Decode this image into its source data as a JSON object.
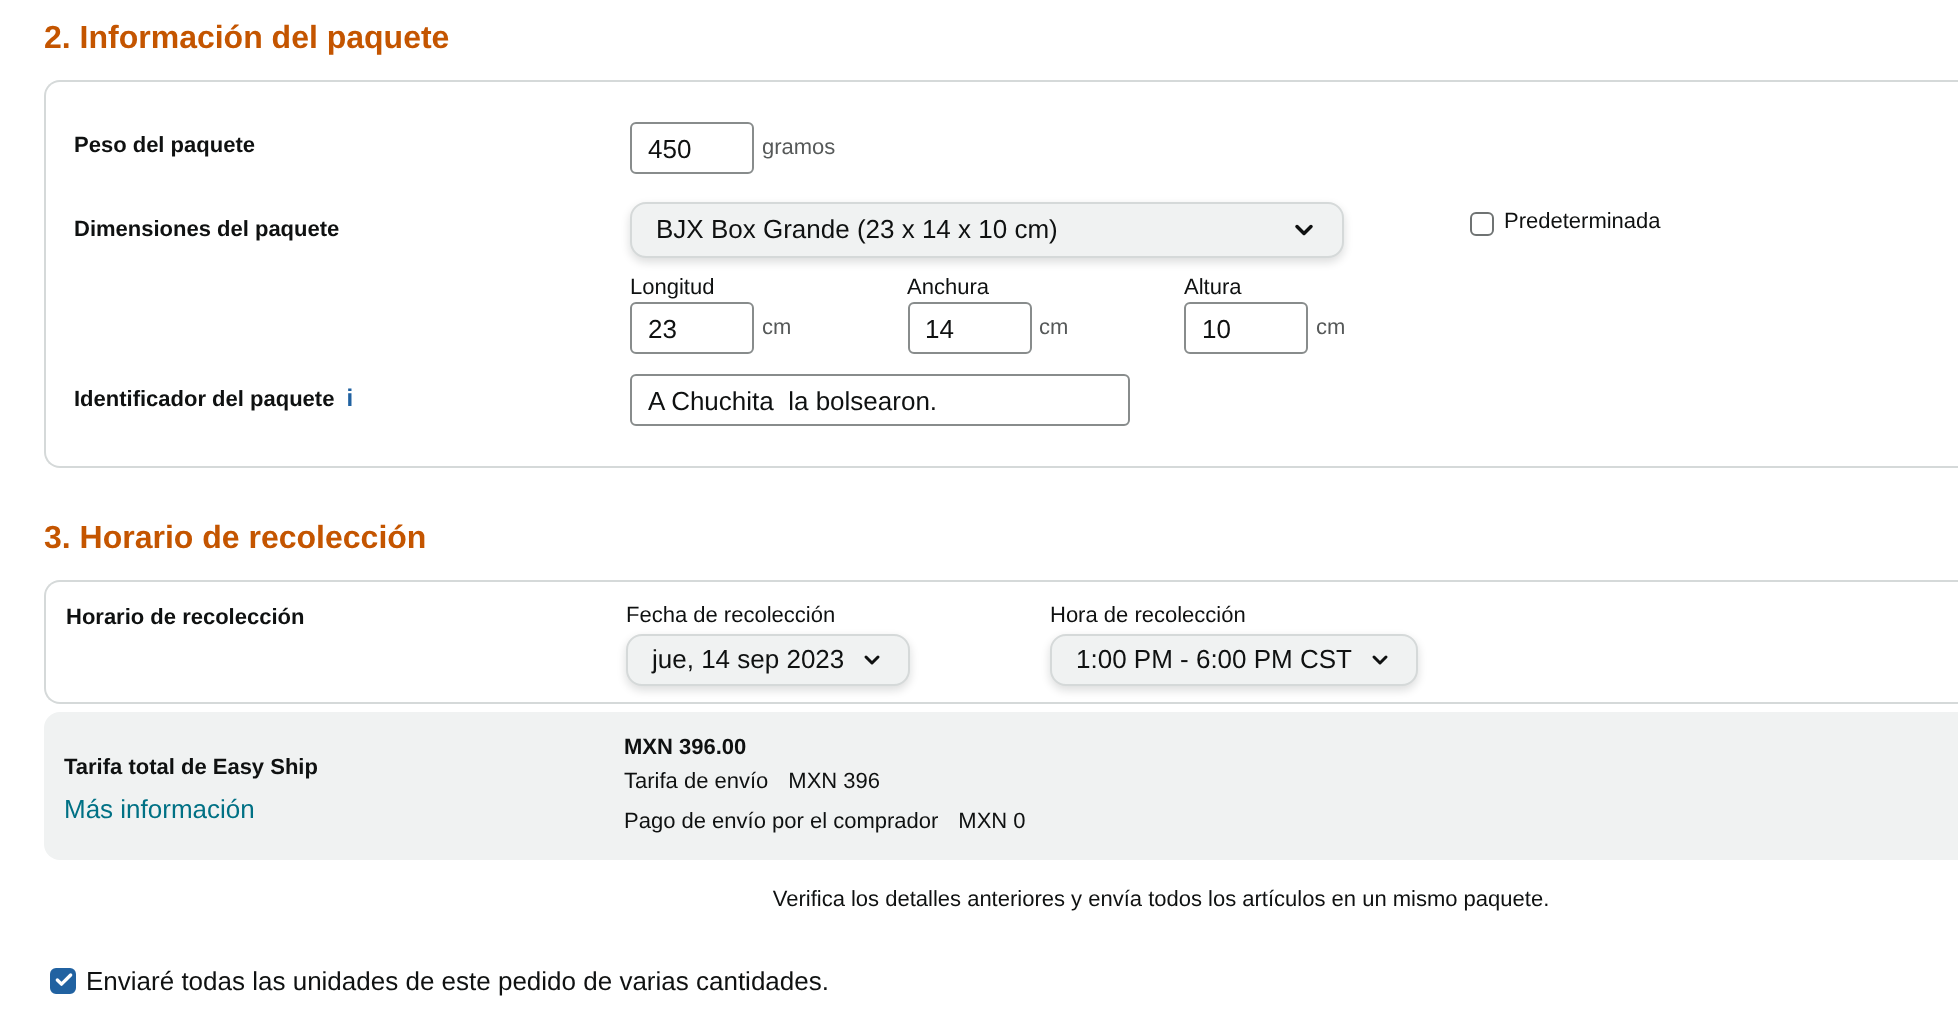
{
  "package_section": {
    "title": "2. Información del paquete",
    "weight": {
      "label": "Peso del paquete",
      "value": "450",
      "unit": "gramos"
    },
    "dimensions": {
      "label": "Dimensiones del paquete",
      "selected_box": "BJX Box Grande (23 x 14 x 10 cm)",
      "default": {
        "label": "Predeterminada",
        "checked": false
      },
      "fields": [
        {
          "label": "Longitud",
          "value": "23",
          "unit": "cm"
        },
        {
          "label": "Anchura",
          "value": "14",
          "unit": "cm"
        },
        {
          "label": "Altura",
          "value": "10",
          "unit": "cm"
        }
      ]
    },
    "identifier": {
      "label": "Identificador del paquete",
      "info": "i",
      "value": "A Chuchita  la bolsearon."
    }
  },
  "pickup_section": {
    "title": "3. Horario de recolección",
    "label": "Horario de recolección",
    "date": {
      "label": "Fecha de recolección",
      "value": "jue, 14 sep 2023"
    },
    "time": {
      "label": "Hora de recolección",
      "value": "1:00 PM - 6:00 PM CST"
    }
  },
  "fee": {
    "label": "Tarifa total de Easy Ship",
    "link": "Más información",
    "total": "MXN 396.00",
    "lines": [
      {
        "label": "Tarifa de envío",
        "amount": "MXN 396"
      },
      {
        "label": "Pago de envío por el comprador",
        "amount": "MXN 0"
      }
    ]
  },
  "note": "Verifica los detalles anteriores y envía todos los artículos en un mismo paquete.",
  "confirm": {
    "label": "Enviaré todas las unidades de este pedido de varias cantidades.",
    "checked": true
  }
}
